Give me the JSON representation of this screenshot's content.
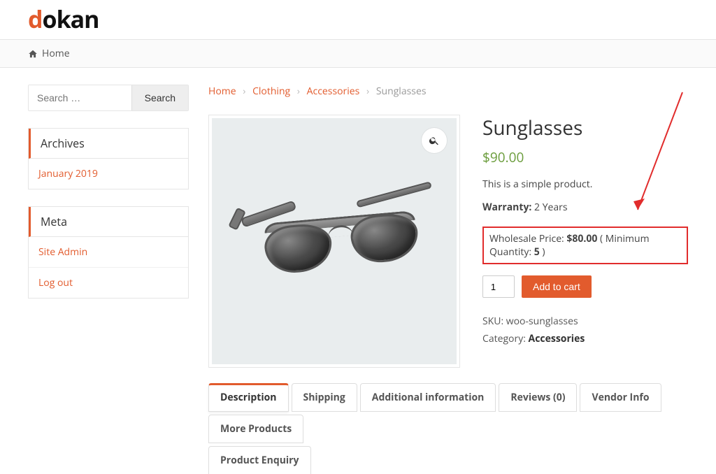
{
  "logo": {
    "d": "d",
    "rest": "okan"
  },
  "nav": {
    "home": "Home"
  },
  "search": {
    "placeholder": "Search …",
    "button": "Search"
  },
  "widgets": {
    "archives": {
      "title": "Archives",
      "items": [
        "January 2019"
      ]
    },
    "meta": {
      "title": "Meta",
      "items": [
        "Site Admin",
        "Log out"
      ]
    }
  },
  "breadcrumb": {
    "home": "Home",
    "clothing": "Clothing",
    "accessories": "Accessories",
    "current": "Sunglasses"
  },
  "product": {
    "title": "Sunglasses",
    "price": "$90.00",
    "description": "This is a simple product.",
    "warranty_label": "Warranty:",
    "warranty_value": "2 Years",
    "wholesale_label": "Wholesale Price: ",
    "wholesale_price": "$80.00",
    "wholesale_min_label": " ( Minimum Quantity: ",
    "wholesale_min_qty": "5",
    "wholesale_close": " )",
    "qty": "1",
    "add_to_cart": "Add to cart",
    "sku_label": "SKU: ",
    "sku": "woo-sunglasses",
    "category_label": "Category: ",
    "category": "Accessories"
  },
  "tabs": {
    "description": "Description",
    "shipping": "Shipping",
    "additional": "Additional information",
    "reviews": "Reviews (0)",
    "vendor": "Vendor Info",
    "more": "More Products",
    "enquiry": "Product Enquiry"
  }
}
